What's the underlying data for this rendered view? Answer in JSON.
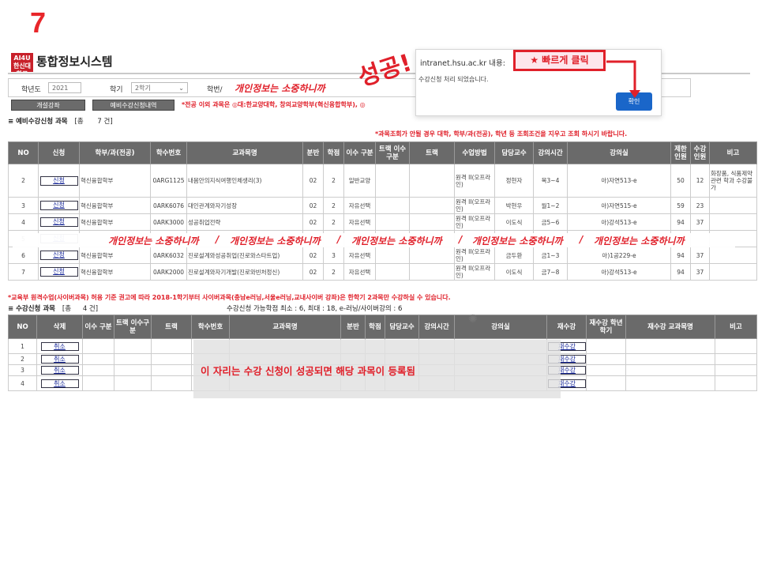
{
  "step_number": "7",
  "app": {
    "logo_text": "AI4U 한신대학교",
    "title": "통합정보시스템"
  },
  "filters": {
    "year_label": "학년도",
    "year_value": "2021",
    "term_label": "학기",
    "term_value": "2학기",
    "dept_label": "학번/"
  },
  "buttons": {
    "open_courses": "개설강좌",
    "preregistered": "예비수강신청내역"
  },
  "notice_top": "*전공 이외 과목은 ◎대:한교양대학, 창의교양학부(혁신융합학부), ◎",
  "privacy_note": "개인정보는 소중하니까",
  "prereg_section": {
    "title": "예비수강신청 과목",
    "count_open": "[총",
    "count": "7 건]"
  },
  "notice_search": "*과목조회가 안될 경우 대학, 학부/과(전공), 학년 등 조회조건을 지우고 조회 하시기 바랍니다.",
  "prereg_table": {
    "headers": [
      "NO",
      "신청",
      "학부/과(전공)",
      "학수번호",
      "교과목명",
      "분반",
      "학점",
      "이수 구분",
      "트랙 이수구분",
      "트랙",
      "수업방법",
      "담당교수",
      "강의시간",
      "강의실",
      "제한 인원",
      "수강 인원",
      "비고"
    ],
    "rows": [
      [
        "2",
        "신청",
        "혁신융합학부",
        "0ARG1125",
        "내몸안의지식여행인체생리(3)",
        "02",
        "2",
        "일반교양",
        "",
        "",
        "원격 II(오프라인)",
        "정현자",
        "목3~4",
        "아)자연513-e",
        "50",
        "12",
        "화장품, 식품제약관련 학과 수강불가"
      ],
      [
        "3",
        "신청",
        "혁신융합학부",
        "0ARK6076",
        "대인관계와자기성장",
        "02",
        "2",
        "자유선택",
        "",
        "",
        "원격 II(오프라인)",
        "박현우",
        "월1~2",
        "아)자연515-e",
        "59",
        "23",
        ""
      ],
      [
        "4",
        "신청",
        "혁신융합학부",
        "0ARK3000",
        "성공취업전략",
        "02",
        "2",
        "자유선택",
        "",
        "",
        "원격 II(오프라인)",
        "이도식",
        "금5~6",
        "아)강석513-e",
        "94",
        "37",
        ""
      ],
      [
        "5",
        "신청",
        "",
        "",
        "",
        "",
        "",
        "",
        "",
        "",
        "",
        "",
        "",
        "",
        "",
        "",
        ""
      ],
      [
        "6",
        "신청",
        "혁신융합학부",
        "0ARK6032",
        "진로설계와성공취업(진로와스타트업)",
        "02",
        "3",
        "자유선택",
        "",
        "",
        "원격 II(오프라인)",
        "금두환",
        "금1~3",
        "아)1공229-e",
        "94",
        "37",
        ""
      ],
      [
        "7",
        "신청",
        "혁신융합학부",
        "0ARK2000",
        "진로설계와자기개발(진로와빈처정신)",
        "02",
        "2",
        "자유선택",
        "",
        "",
        "원격 II(오프라인)",
        "이도식",
        "금7~8",
        "아)강석513-e",
        "94",
        "37",
        ""
      ]
    ]
  },
  "privacy_banner": [
    "개인정보는 소중하니까",
    "/",
    "개인정보는 소중하니까",
    "/",
    "개인정보는 소중하니까",
    "/",
    "개인정보는 소중하니까",
    "/",
    "개인정보는 소중하니까"
  ],
  "notice_cyber": "*교육부 원격수업(사이버과목) 허용 기준 권고에 따라 2018-1학기부터 사이버과목(충남e러닝,서울e러닝,교내사이버 강좌)은 한학기 2과목만 수강하실 수 있습니다.",
  "reg_section": {
    "title": "수강신청 과목",
    "count_open": "[총",
    "count": "4 건]",
    "credits_info": "수강신청 가능학점 최소 : 6, 최대 : 18, e-러닝/사이버강의 : 6"
  },
  "reg_table": {
    "headers": [
      "NO",
      "삭제",
      "이수 구분",
      "트랙 이수구분",
      "트랙",
      "학수번호",
      "교과목명",
      "분반",
      "학점",
      "담당교수",
      "강의시간",
      "강의실",
      "재수강",
      "재수강 학년 학기",
      "재수강 교과목명",
      "비고"
    ],
    "rows": [
      [
        "1",
        "취소",
        "재수강"
      ],
      [
        "2",
        "취소",
        "재수강"
      ],
      [
        "3",
        "취소",
        "재수강"
      ],
      [
        "4",
        "취소",
        "재수강"
      ]
    ]
  },
  "overlay_text": "이 자리는 수강 신청이 성공되면 해당 과목이 등록됨",
  "dialog": {
    "host": "intranet.hsu.ac.kr 내용:",
    "message": "수강신청 처리 되었습니다.",
    "ok": "확인"
  },
  "annotation": {
    "quick_click": "★ 빠르게 클릭",
    "success": "성공!"
  },
  "colors": {
    "accent_red": "#e0202a",
    "header_gray": "#6a6a6a",
    "dialog_blue": "#1a66c9"
  }
}
